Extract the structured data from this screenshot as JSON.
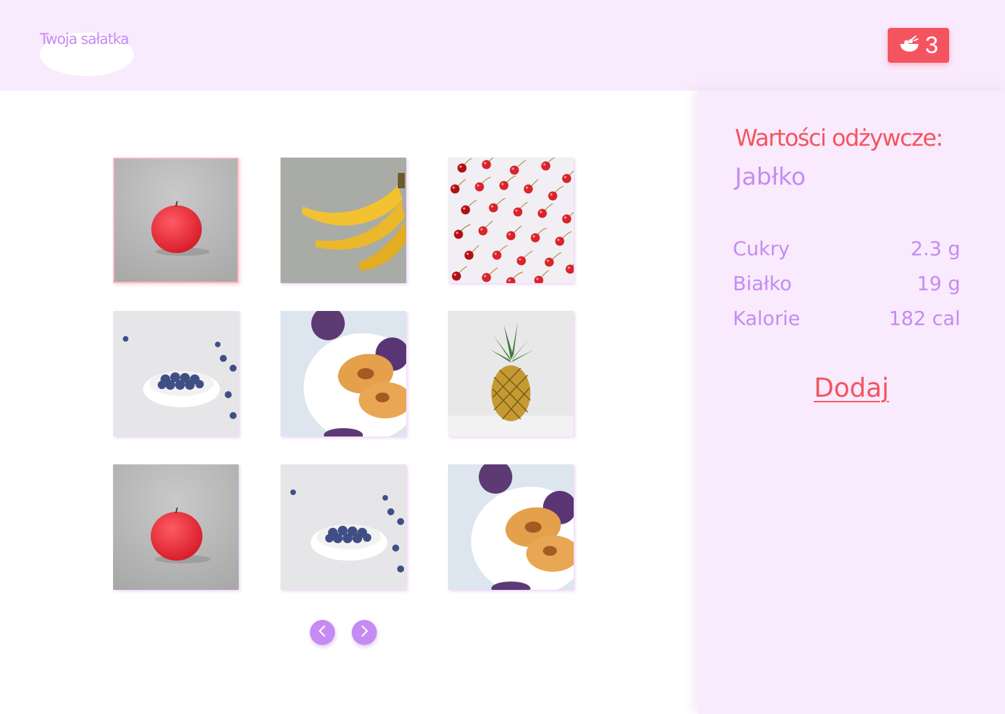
{
  "header": {
    "logo_text": "Twoja sałatka",
    "cart_count": "3",
    "cart_icon": "salad-bowl-icon"
  },
  "gallery": {
    "items": [
      {
        "fruit": "apple",
        "selected": true
      },
      {
        "fruit": "banana",
        "selected": false
      },
      {
        "fruit": "cherries",
        "selected": false
      },
      {
        "fruit": "blueberries",
        "selected": false
      },
      {
        "fruit": "plums",
        "selected": false
      },
      {
        "fruit": "pineapple",
        "selected": false
      },
      {
        "fruit": "apple",
        "selected": false
      },
      {
        "fruit": "blueberries",
        "selected": false
      },
      {
        "fruit": "plums",
        "selected": false
      }
    ],
    "prev_icon": "chevron-left-icon",
    "next_icon": "chevron-right-icon"
  },
  "panel": {
    "heading": "Wartości odżywcze:",
    "fruit_name": "Jabłko",
    "nutrients": [
      {
        "label": "Cukry",
        "value": "2.3 g"
      },
      {
        "label": "Białko",
        "value": "19 g"
      },
      {
        "label": "Kalorie",
        "value": "182 cal"
      }
    ],
    "add_label": "Dodaj"
  },
  "colors": {
    "accent_red": "#f4545f",
    "accent_purple": "#c58bf2",
    "panel_bg": "#f9eafd"
  }
}
